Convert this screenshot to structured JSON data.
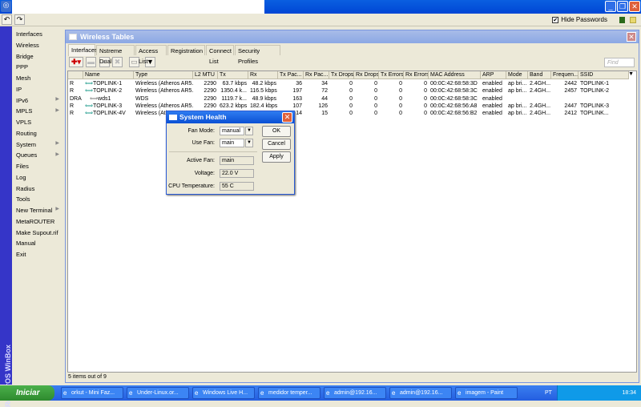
{
  "toolbar": {
    "undo": "↶",
    "redo": "↷",
    "hide_passwords_label": "Hide Passwords",
    "hide_passwords_checked": true
  },
  "sidebar": {
    "vertical_label": "RouterOS WinBox",
    "items": [
      {
        "label": "Interfaces",
        "sub": false
      },
      {
        "label": "Wireless",
        "sub": false
      },
      {
        "label": "Bridge",
        "sub": false
      },
      {
        "label": "PPP",
        "sub": false
      },
      {
        "label": "Mesh",
        "sub": false
      },
      {
        "label": "IP",
        "sub": true
      },
      {
        "label": "IPv6",
        "sub": true
      },
      {
        "label": "MPLS",
        "sub": false
      },
      {
        "label": "VPLS",
        "sub": false
      },
      {
        "label": "Routing",
        "sub": true
      },
      {
        "label": "System",
        "sub": true
      },
      {
        "label": "Queues",
        "sub": false
      },
      {
        "label": "Files",
        "sub": false
      },
      {
        "label": "Log",
        "sub": false
      },
      {
        "label": "Radius",
        "sub": false
      },
      {
        "label": "Tools",
        "sub": true
      },
      {
        "label": "New Terminal",
        "sub": false
      },
      {
        "label": "MetaROUTER",
        "sub": false
      },
      {
        "label": "Make Supout.rif",
        "sub": false
      },
      {
        "label": "Manual",
        "sub": false
      },
      {
        "label": "Exit",
        "sub": false
      }
    ]
  },
  "wireless_tables": {
    "title": "Wireless Tables",
    "tabs": [
      "Interfaces",
      "Nstreme Dual",
      "Access List",
      "Registration",
      "Connect List",
      "Security Profiles"
    ],
    "find_placeholder": "Find",
    "columns": [
      "",
      "Name",
      "Type",
      "L2 MTU",
      "Tx",
      "Rx",
      "Tx Pac...",
      "Rx Pac...",
      "Tx Drops",
      "Rx Drops",
      "Tx Errors",
      "Rx Errors",
      "MAC Address",
      "ARP",
      "Mode",
      "Band",
      "Frequen...",
      "SSID"
    ],
    "rows": [
      [
        "R",
        "TOPLINK-1",
        "Wireless (Atheros AR5...",
        "2290",
        "63.7 kbps",
        "48.2 kbps",
        "36",
        "34",
        "0",
        "0",
        "0",
        "0",
        "00:0C:42:68:58:3D",
        "enabled",
        "ap bri...",
        "2.4GH...",
        "2442",
        "TOPLINK-1"
      ],
      [
        "R",
        "TOPLINK-2",
        "Wireless (Atheros AR5...",
        "2290",
        "1350.4 k...",
        "116.5 kbps",
        "197",
        "72",
        "0",
        "0",
        "0",
        "0",
        "00:0C:42:68:58:3C",
        "enabled",
        "ap bri...",
        "2.4GH...",
        "2457",
        "TOPLINK-2"
      ],
      [
        "DRA",
        "wds1",
        "WDS",
        "2290",
        "1119.7 k...",
        "48.9 kbps",
        "163",
        "44",
        "0",
        "0",
        "0",
        "0",
        "00:0C:42:68:58:3C",
        "enabled",
        "",
        "",
        "",
        ""
      ],
      [
        "R",
        "TOPLINK-3",
        "Wireless (Atheros AR5...",
        "2290",
        "623.2 kbps",
        "182.4 kbps",
        "107",
        "126",
        "0",
        "0",
        "0",
        "0",
        "00:0C:42:68:56:A8",
        "enabled",
        "ap bri...",
        "2.4GH...",
        "2447",
        "TOPLINK-3"
      ],
      [
        "R",
        "TOPLINK-4V",
        "Wireless (Atheros AR5...",
        "2290",
        "",
        "",
        "14",
        "15",
        "0",
        "0",
        "0",
        "0",
        "00:0C:42:68:56:B2",
        "enabled",
        "ap bri...",
        "2.4GH...",
        "2412",
        "TOPLINK..."
      ]
    ],
    "status": "5 items out of 9"
  },
  "system_health": {
    "title": "System Health",
    "fan_mode_label": "Fan Mode:",
    "fan_mode": "manual",
    "use_fan_label": "Use Fan:",
    "use_fan": "main",
    "active_fan_label": "Active Fan:",
    "active_fan": "main",
    "voltage_label": "Voltage:",
    "voltage": "22.0 V",
    "cpu_temp_label": "CPU Temperature:",
    "cpu_temp": "55 C",
    "ok": "OK",
    "cancel": "Cancel",
    "apply": "Apply"
  },
  "taskbar": {
    "start": "Iniciar",
    "tasks": [
      "orkut - Mini Faz...",
      "Under-Linux.or...",
      "Windows Live H...",
      "medidor temper...",
      "admin@192.16...",
      "admin@192.16...",
      "imagem - Paint"
    ],
    "lang": "PT",
    "clock": "18:34"
  }
}
